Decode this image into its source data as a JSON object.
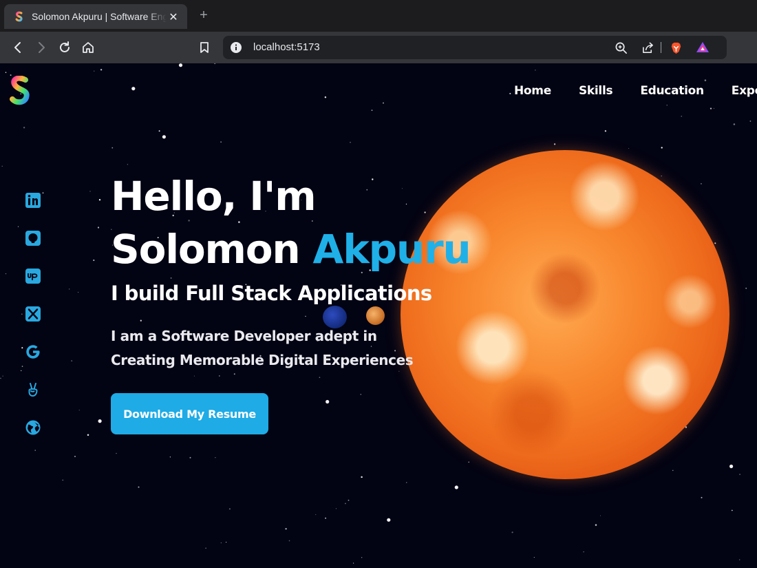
{
  "browser": {
    "tab_title": "Solomon Akpuru | Software Engineer",
    "tab_close_label": "✕",
    "new_tab_label": "+",
    "url": "localhost:5173"
  },
  "nav": {
    "items": [
      "Home",
      "Skills",
      "Education",
      "Exper"
    ]
  },
  "hero": {
    "greeting": "Hello, I'm",
    "first_name": "Solomon",
    "last_name": "Akpuru",
    "subtitle": "I build Full Stack Applications",
    "description_line1": "I am a Software Developer adept in",
    "description_line2": "Creating Memorable Digital Experiences",
    "cta_label": "Download My Resume"
  },
  "socials": [
    "linkedin-icon",
    "github-icon",
    "upwork-icon",
    "x-twitter-icon",
    "google-icon",
    "angellist-icon",
    "globe-icon"
  ],
  "colors": {
    "accent": "#1fb0e8",
    "button": "#1eabe6",
    "background": "#020313",
    "sun": "#f8862d"
  }
}
